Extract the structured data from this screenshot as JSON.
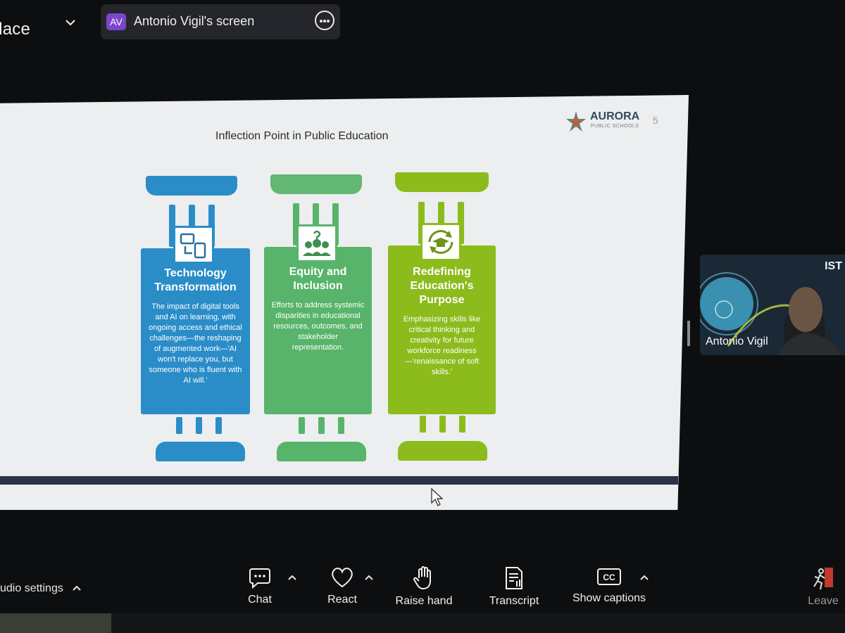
{
  "header": {
    "app_title": "Place",
    "share_initials": "AV",
    "share_label": "Antonio Vigil's screen"
  },
  "slide": {
    "title": "Inflection Point in Public Education",
    "logo_name": "AURORA",
    "logo_subtitle": "PUBLIC SCHOOLS",
    "page_number": "5",
    "pillars": [
      {
        "heading": "Technology Transformation",
        "body": "The impact of digital tools and AI on learning, with ongoing access and ethical challenges—the reshaping of augmented work—'AI won't replace you, but someone who is fluent with AI will.'",
        "icon": "devices-icon",
        "color": "#2a8dc8",
        "cap_color": "#2a8dc8"
      },
      {
        "heading": "Equity and Inclusion",
        "body": "Efforts to address systemic disparities in educational resources, outcomes, and stakeholder representation.",
        "icon": "people-question-icon",
        "color": "#58b46a",
        "cap_color": "#62b872"
      },
      {
        "heading": "Redefining Education's Purpose",
        "body": "Emphasizing skills like critical thinking and creativity for future workforce readiness—'renaissance of soft skills.'",
        "icon": "graduation-cycle-icon",
        "color": "#8cbb1c",
        "cap_color": "#8cbb1c"
      }
    ]
  },
  "video_tile": {
    "participant_name": "Antonio Vigil",
    "overlay_tag": "IST"
  },
  "toolbar": {
    "audio_settings_label": "udio settings",
    "chat_label": "Chat",
    "react_label": "React",
    "raise_hand_label": "Raise hand",
    "transcript_label": "Transcript",
    "captions_label": "Show captions",
    "leave_label": "Leave"
  },
  "colors": {
    "background": "#0d0e10",
    "share_pill": "#24262b",
    "avatar_badge": "#7b46c9",
    "slide_background": "#eceeef",
    "slide_bar": "#2b3347"
  }
}
